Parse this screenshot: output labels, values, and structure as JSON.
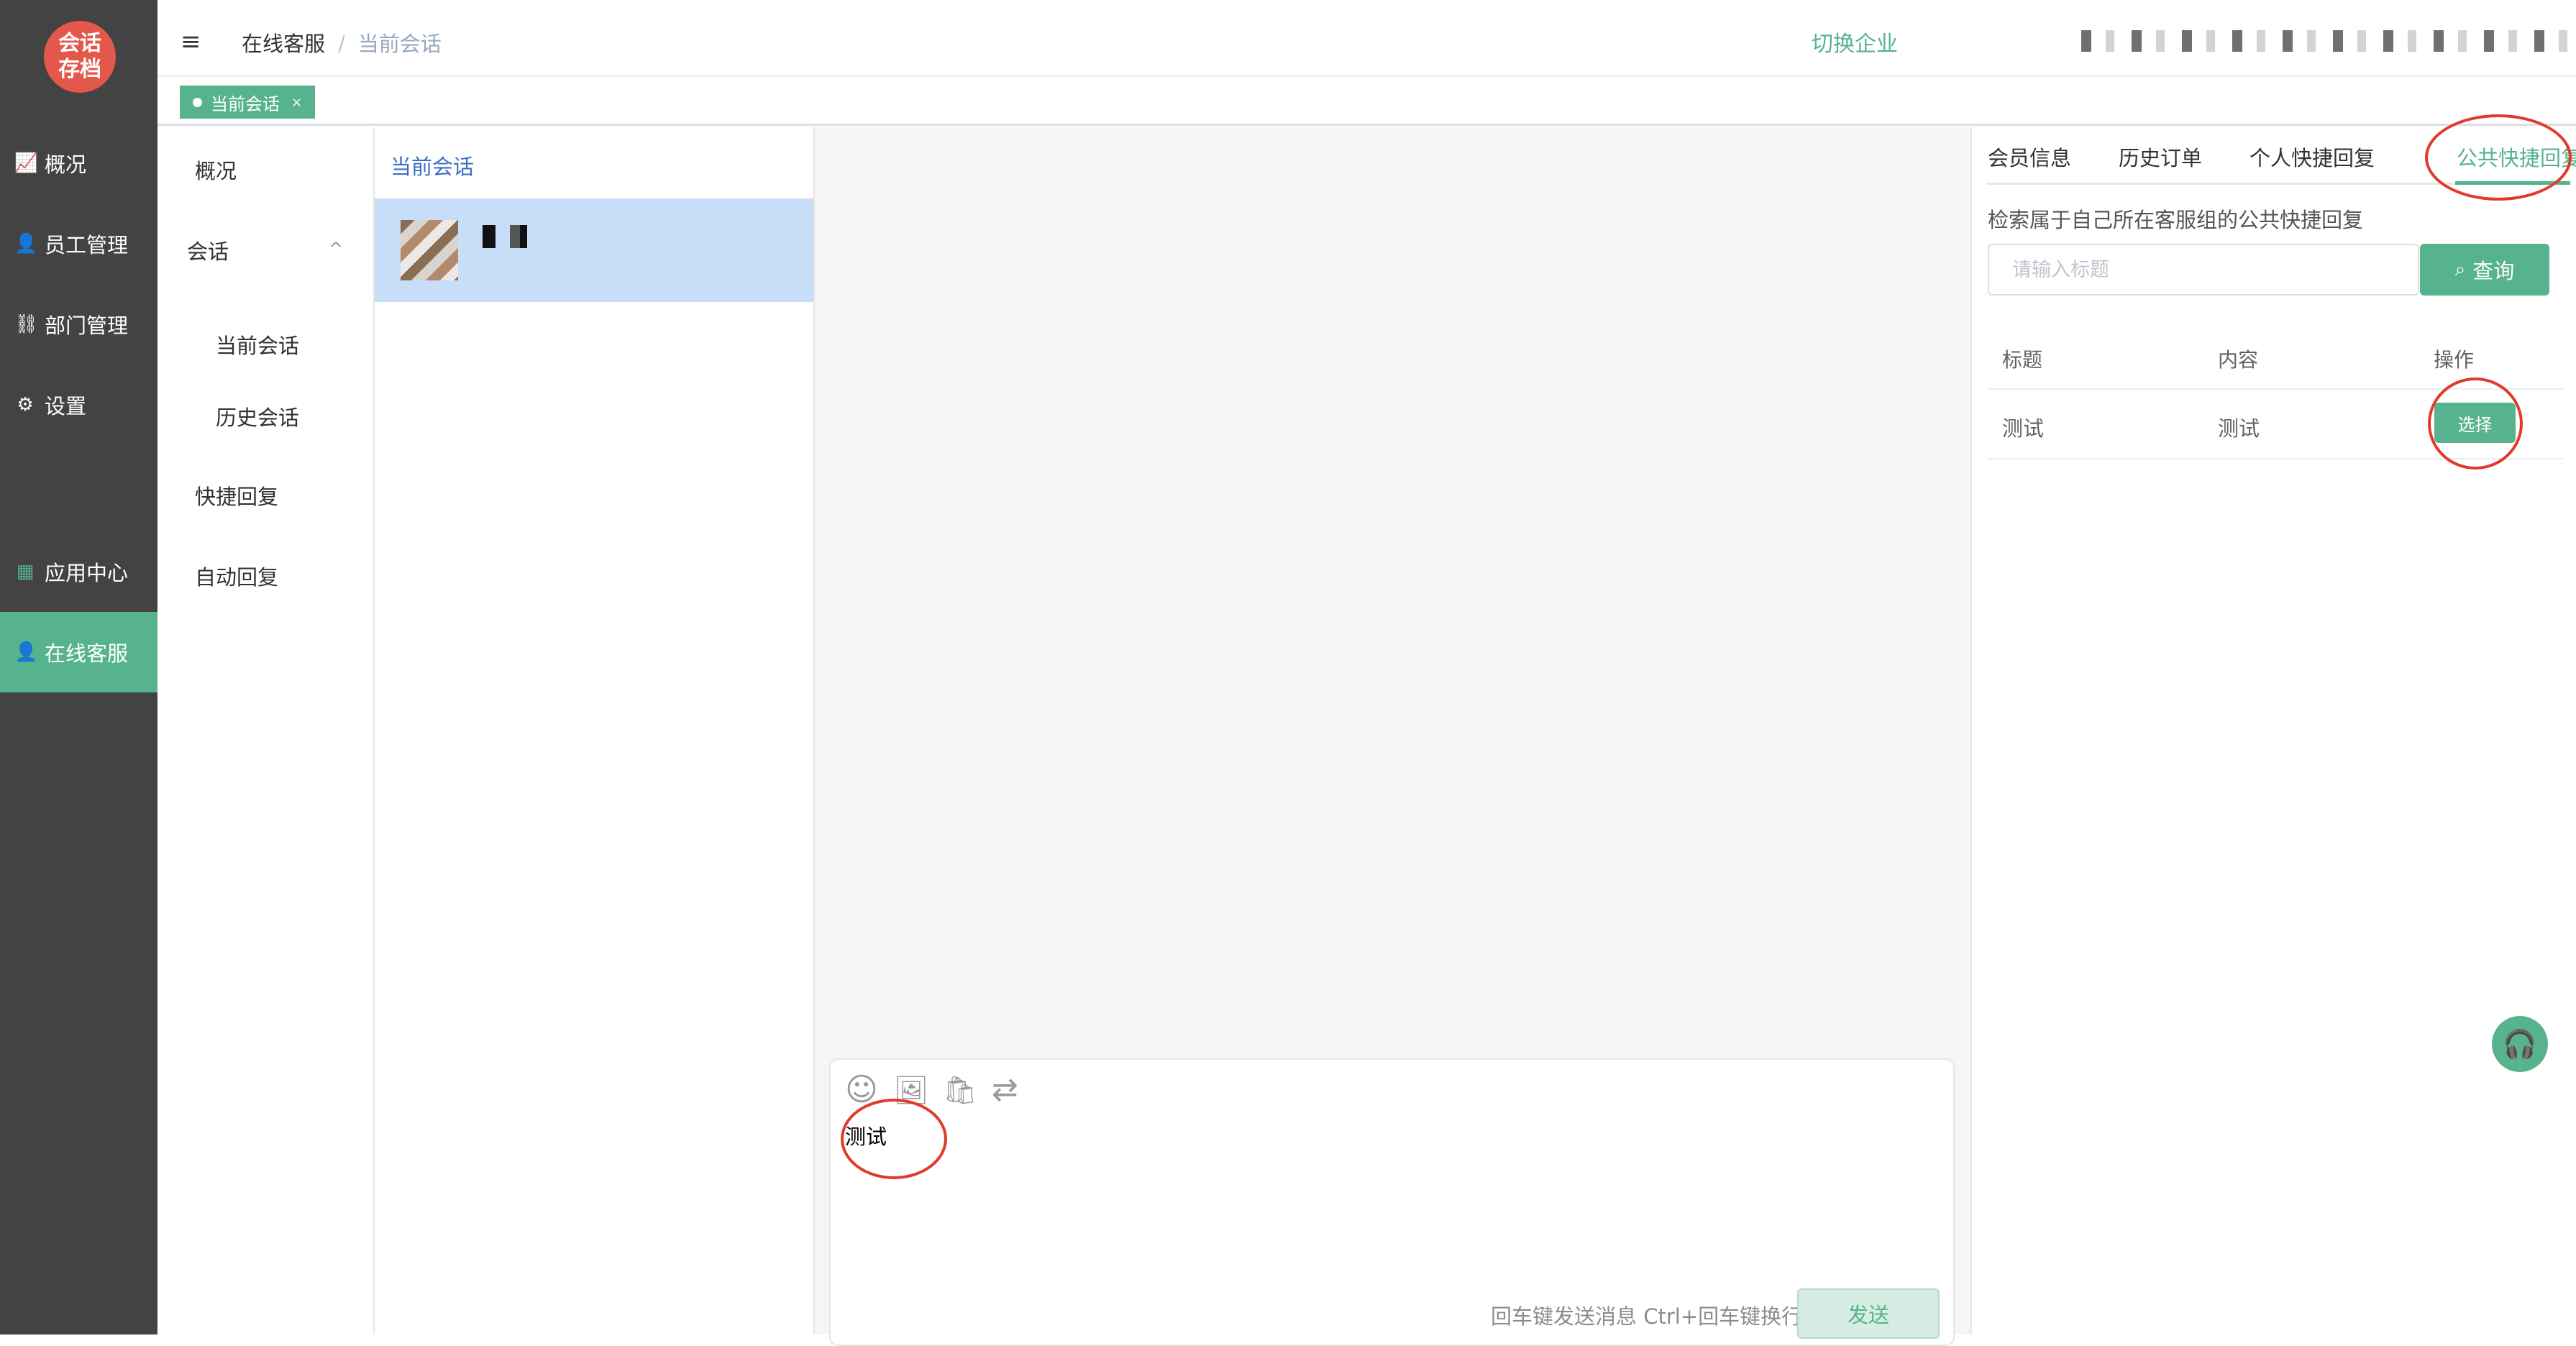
{
  "sidebar": {
    "logo": "会话\n存档",
    "items": [
      {
        "icon": "chart-line-icon",
        "glyph": "📈",
        "label": "概况"
      },
      {
        "icon": "staff-icon",
        "glyph": "👤",
        "label": "员工管理"
      },
      {
        "icon": "org-chart-icon",
        "glyph": "⛓",
        "label": "部门管理"
      },
      {
        "icon": "gear-icon",
        "glyph": "⚙",
        "label": "设置"
      },
      {
        "icon": "app-grid-icon",
        "glyph": "▦",
        "label": "应用中心"
      },
      {
        "icon": "customer-service-icon",
        "glyph": "👤",
        "label": "在线客服",
        "active": true
      }
    ]
  },
  "header": {
    "menu_icon": "≡",
    "breadcrumb": [
      "在线客服",
      "当前会话"
    ],
    "breadcrumb_sep": "/",
    "switch_enterprise": "切换企业"
  },
  "tags": [
    {
      "label": "当前会话",
      "close": "×"
    }
  ],
  "submenu": {
    "overview": "概况",
    "session": "会话",
    "session_arrow": "^",
    "current_session": "当前会话",
    "history_session": "历史会话",
    "quick_reply": "快捷回复",
    "auto_reply": "自动回复"
  },
  "conversation_list": {
    "title": "当前会话"
  },
  "composer": {
    "tools": [
      {
        "icon": "emoji-icon",
        "glyph": "☺"
      },
      {
        "icon": "image-icon",
        "glyph": "🖼"
      },
      {
        "icon": "bag-icon",
        "glyph": "🛍"
      },
      {
        "icon": "transfer-icon",
        "glyph": "⇄"
      }
    ],
    "text": "测试",
    "hint": "回车键发送消息 Ctrl+回车键换行",
    "send": "发送"
  },
  "right_panel": {
    "tabs": [
      "会员信息",
      "历史订单",
      "个人快捷回复",
      "公共快捷回复"
    ],
    "active_tab": 3,
    "description": "检索属于自己所在客服组的公共快捷回复",
    "search_placeholder": "请输入标题",
    "query_button": "查询",
    "table": {
      "headers": [
        "标题",
        "内容",
        "操作"
      ],
      "rows": [
        {
          "title": "测试",
          "content": "测试",
          "action": "选择"
        }
      ]
    }
  },
  "colors": {
    "accent": "#56b38d",
    "sidebar_bg": "#434343",
    "logo_bg": "#e4574b",
    "annotation": "#e03a2a",
    "selected_row": "#c7ddf8"
  }
}
